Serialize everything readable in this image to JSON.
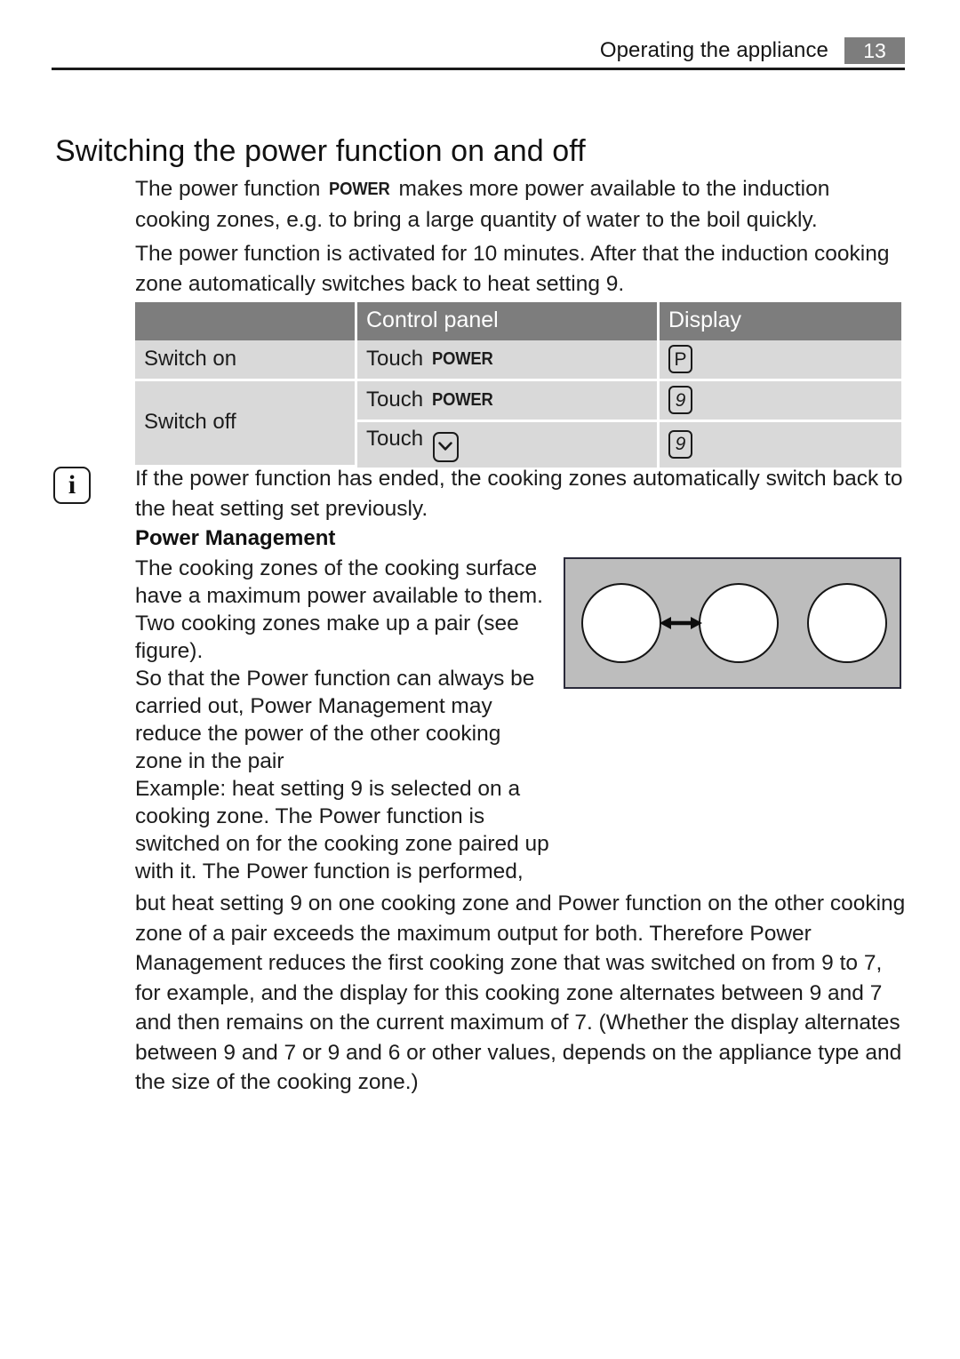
{
  "header": {
    "title": "Operating the appliance",
    "page_number": "13"
  },
  "doc_title": "Switching the power function on and off",
  "intro": {
    "para1_before": "The power function ",
    "power_tag": "POWER",
    "para1_after": " makes more power available to the induction cooking zones, e.g. to bring a large quantity of water to the boil quickly.",
    "para2": "The power function is activated for 10 minutes. After that the induction cooking zone automatically switches back to heat setting 9."
  },
  "table": {
    "headers": {
      "action": "",
      "control_panel": "Control panel",
      "display": "Display"
    },
    "rows": [
      {
        "action": "Switch on",
        "control_panel_prefix": "Touch ",
        "control_panel_tag": "POWER",
        "control_panel_icon": "",
        "display": "P"
      },
      {
        "action": "Switch off",
        "control_panel_prefix": "Touch ",
        "control_panel_tag": "POWER",
        "control_panel_icon": "",
        "display": "9"
      },
      {
        "action": "",
        "control_panel_prefix": "Touch ",
        "control_panel_tag": "",
        "control_panel_icon": "chevron-down-icon",
        "display": "9"
      }
    ]
  },
  "note": {
    "icon": "info-icon",
    "icon_glyph": "i",
    "text": "If the power function has ended, the cooking zones automatically switch back to the heat setting set previously."
  },
  "power_management": {
    "heading": "Power Management",
    "left_paragraphs": [
      "The cooking zones of the cooking surface have a maximum power available to them. Two cooking zones make up a pair (see figure).",
      "So that the Power function can always be carried out, Power Management may reduce the power of the other cooking zone in the pair",
      "Example: heat setting 9 is selected on a cooking zone. The Power function is switched on for the cooking zone paired up with it. The Power function is performed,"
    ],
    "bottom_paragraph": "but heat setting 9 on one cooking zone and Power function on the other cooking zone of a pair exceeds the maximum output for both. Therefore Power Management reduces the first cooking zone that was switched on from 9 to 7, for example, and the display for this cooking zone alternates between 9 and 7 and then remains on the current maximum of 7. (Whether the display alternates between 9 and 7 or 9 and 6 or other values, depends on the appliance type and the size of the cooking zone.)"
  },
  "figure": {
    "name": "cooking-zones-pair-diagram",
    "zone_count": 3,
    "paired_zones": [
      1,
      2
    ],
    "arrow": "double-headed-arrow",
    "surface_color": "#bdbdbd",
    "zone_color": "#ffffff"
  },
  "colors": {
    "table_header_gray": "#7d7d7d",
    "table_cell_gray": "#d9d9d9",
    "ink": "#1c1c1c"
  }
}
